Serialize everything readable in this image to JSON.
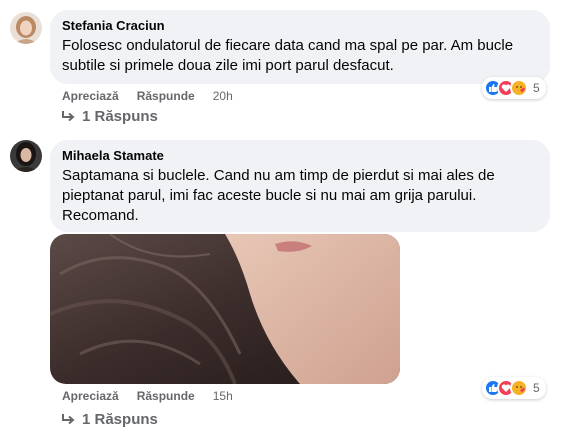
{
  "comments": [
    {
      "author": "Stefania Craciun",
      "text": "Folosesc ondulatorul de fiecare data cand ma spal pe par. Am bucle subtile si primele doua zile imi port parul desfacut.",
      "like_label": "Apreciază",
      "reply_label": "Răspunde",
      "time": "20h",
      "reaction_count": "5",
      "replies_label": "1 Răspuns"
    },
    {
      "author": "Mihaela Stamate",
      "text": "Saptamana si buclele. Cand nu am timp de pierdut si mai ales de pieptanat parul, imi fac aceste bucle si nu mai am grija parului. Recomand.",
      "like_label": "Apreciază",
      "reply_label": "Răspunde",
      "time": "15h",
      "reaction_count": "5",
      "replies_label": "1 Răspuns"
    }
  ],
  "colors": {
    "bubble": "#f0f2f5",
    "meta": "#65676b",
    "like": "#1877f2",
    "love": "#f33e58",
    "care": "#f7b125"
  }
}
